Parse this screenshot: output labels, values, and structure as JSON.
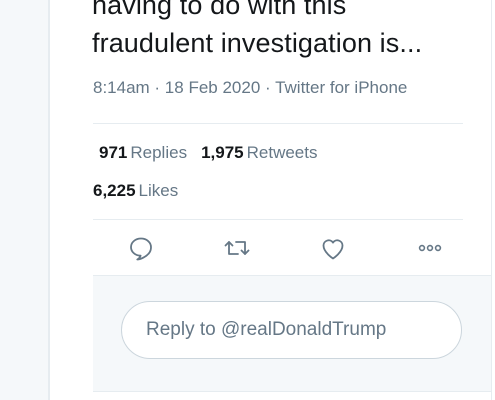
{
  "tweet": {
    "text": "having to do with this\nfraudulent investigation is...",
    "meta": "8:14am · 18 Feb 2020 · Twitter for iPhone"
  },
  "stats": {
    "replies_count": "971",
    "replies_label": "Replies",
    "retweets_count": "1,975",
    "retweets_label": "Retweets",
    "likes_count": "6,225",
    "likes_label": "Likes"
  },
  "actions": {
    "icons": [
      "reply-icon",
      "retweet-icon",
      "like-icon",
      "more-icon"
    ]
  },
  "reply": {
    "placeholder": "Reply to @realDonaldTrump"
  },
  "colors": {
    "text": "#14171a",
    "secondary": "#657786",
    "border": "#e6ecf0",
    "panel": "#f5f8fa"
  }
}
